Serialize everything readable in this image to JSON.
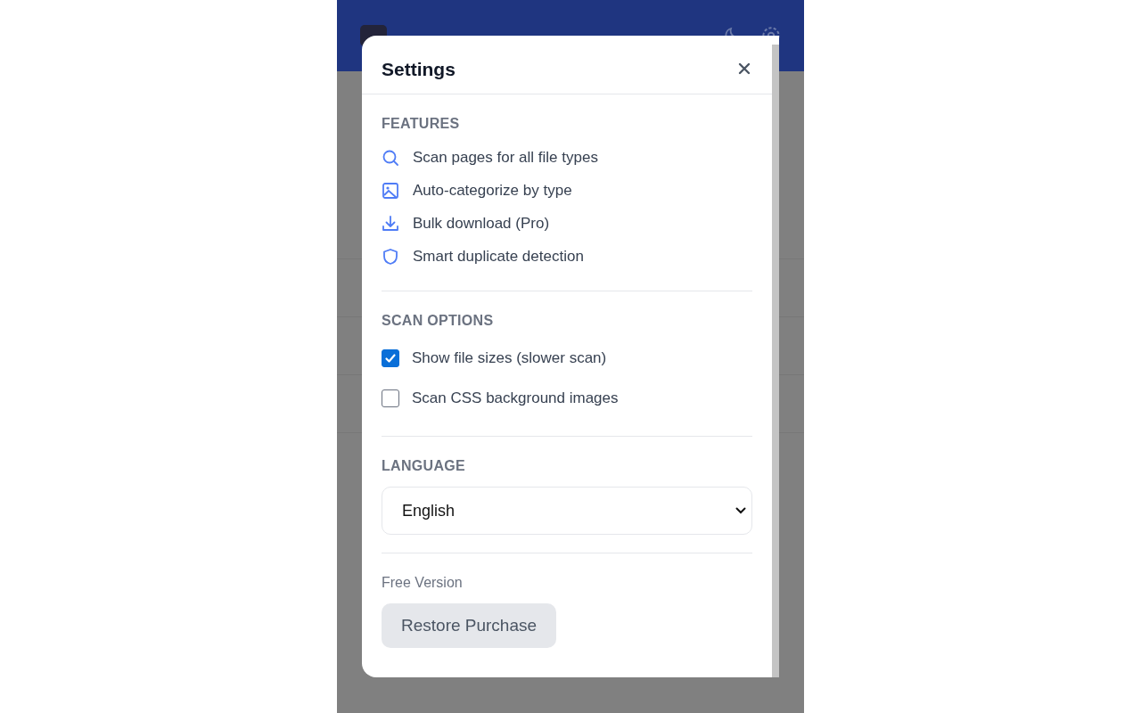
{
  "settings_dialog": {
    "title": "Settings",
    "features": {
      "heading": "FEATURES",
      "items": [
        "Scan pages for all file types",
        "Auto-categorize by type",
        "Bulk download (Pro)",
        "Smart duplicate detection"
      ]
    },
    "scan_options": {
      "heading": "SCAN OPTIONS",
      "options": [
        {
          "label": "Show file sizes (slower scan)",
          "checked": true
        },
        {
          "label": "Scan CSS background images",
          "checked": false
        }
      ]
    },
    "language": {
      "heading": "LANGUAGE",
      "value": "English"
    },
    "license": {
      "status": "Free Version",
      "button": "Restore Purchase"
    }
  }
}
